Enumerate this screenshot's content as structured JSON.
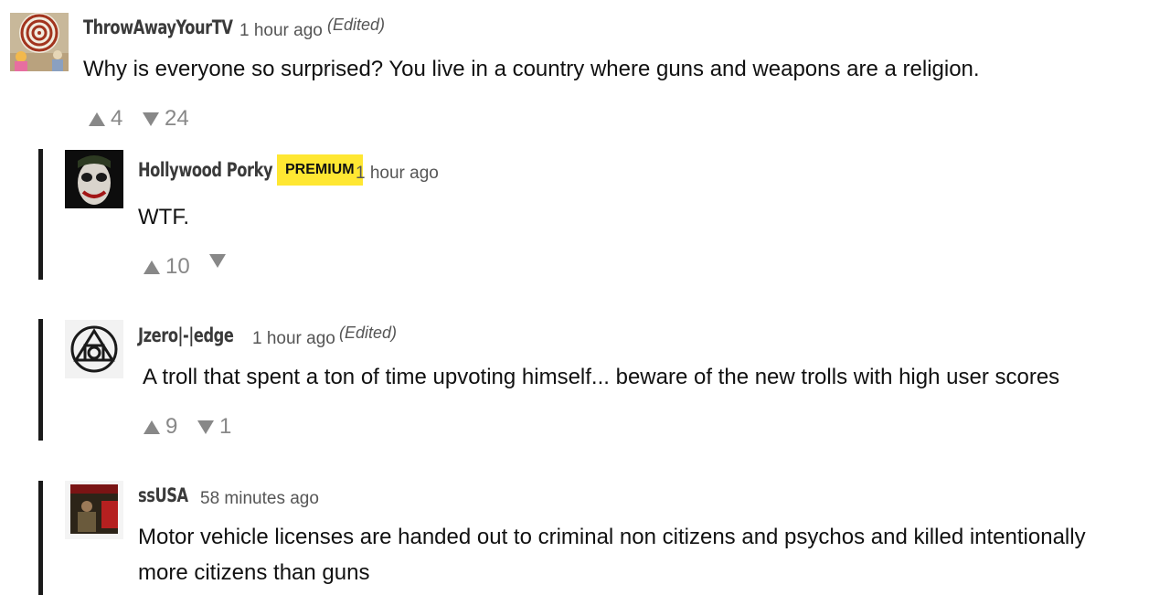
{
  "comments": [
    {
      "author": "ThrowAwayYourTV",
      "time": "1 hour ago",
      "edited": "(Edited)",
      "text": "Why is everyone so surprised? You live in a country where guns and weapons are a religion.",
      "upvotes": "4",
      "downvotes": "24",
      "avatar_icon": "spiral-avatar"
    },
    {
      "author": "Hollywood Porky",
      "badge": "PREMIUM",
      "time": "1 hour ago",
      "text": "WTF.",
      "upvotes": "10",
      "downvotes": "",
      "avatar_icon": "joker-avatar"
    },
    {
      "author": "Jzero|-|edge",
      "time": "1 hour ago",
      "edited": "(Edited)",
      "text": "A troll that spent a ton of time upvoting himself... beware of the new trolls with high user scores",
      "upvotes": "9",
      "downvotes": "1",
      "avatar_icon": "alchemy-symbol-avatar"
    },
    {
      "author": "ssUSA",
      "time": "58 minutes ago",
      "text_line1": "Motor vehicle licenses are handed out  to criminal non citizens and psychos and killed intentionally",
      "text_line2": "more citizens than guns",
      "avatar_icon": "photo-avatar"
    }
  ],
  "colors": {
    "badge": "#ffe732",
    "thread_bar": "#1a1a1a",
    "vote_gray": "#888888",
    "author_gray": "#3a3a3a"
  }
}
